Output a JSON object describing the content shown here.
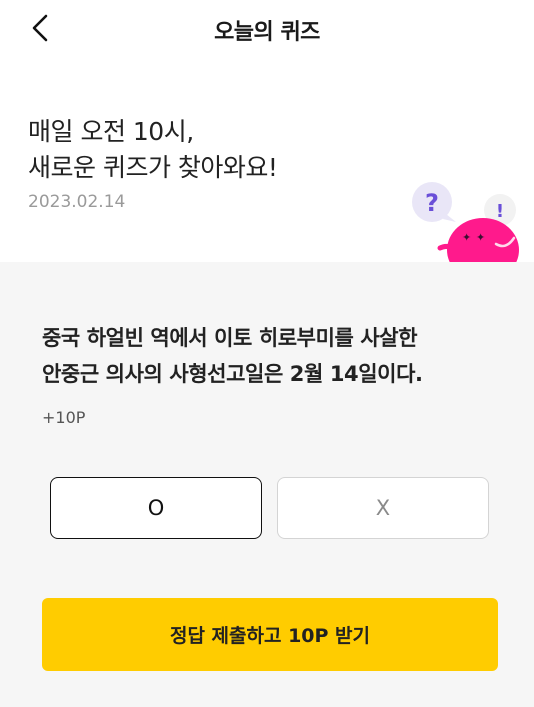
{
  "header": {
    "back_icon": "chevron-left-icon",
    "title": "오늘의 퀴즈"
  },
  "intro": {
    "line1": "매일 오전 10시,",
    "line2": "새로운 퀴즈가 찾아와요!",
    "date": "2023.02.14"
  },
  "mascot": {
    "question_mark": "?",
    "exclamation_mark": "!",
    "icon": "quiz-mascot-icon"
  },
  "quiz": {
    "question_line1": "중국 하얼빈 역에서 이토 히로부미를 사살한",
    "question_line2": "안중근 의사의 사형선고일은 2월 14일이다.",
    "points": "+10P",
    "option_o": "O",
    "option_x": "X",
    "submit_label": "정답 제출하고 10P 받기"
  },
  "colors": {
    "accent": "#ffcc00",
    "panel_bg": "#f6f6f6",
    "mascot_pink": "#ff1a8c",
    "bubble": "#e9e6f7",
    "question_purple": "#6a4fd8"
  }
}
